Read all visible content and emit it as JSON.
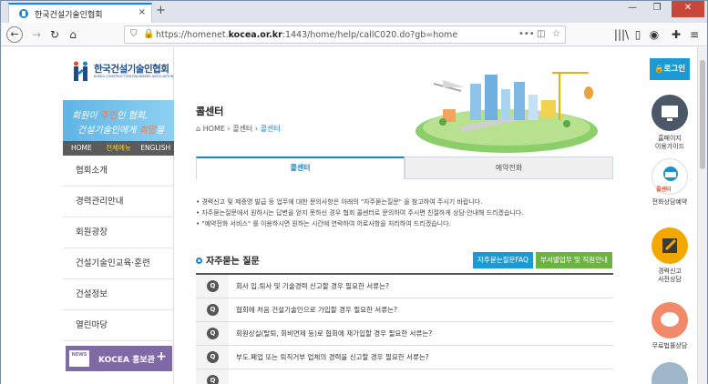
{
  "browser": {
    "tab_title": "한국건설기술인협회",
    "tab_close": "×",
    "new_tab": "+",
    "url_prefix": "https://homenet.",
    "url_domain": "kocea.or.kr",
    "url_suffix": ":1443/home/help/callC020.do?gb=home"
  },
  "logo": {
    "name": "한국건설기술인협회",
    "sub": "KOREA CONSTRUCTION ENGINEERS ASSOCIATION"
  },
  "banner": {
    "line1_a": "회원이 ",
    "line1_hl": "주인",
    "line1_b": "인 협회,",
    "line2_a": "건설기술인에게 ",
    "line2_hl": "희망",
    "line2_b": "을"
  },
  "topmenu": [
    "HOME",
    "전체메뉴",
    "ENGLISH"
  ],
  "sidebar_menu": [
    "협회소개",
    "경력관리안내",
    "회원광장",
    "건설기술인교육·훈련",
    "건설정보",
    "열린마당"
  ],
  "kocea": {
    "news": "NEWS",
    "label": "KOCEA 홍보관",
    "plus": "+"
  },
  "page": {
    "title": "콜센터",
    "breadcrumb": [
      "HOME",
      "콜센터",
      "콜센터"
    ]
  },
  "tabs": [
    "콜센터",
    "예약전화"
  ],
  "notes": [
    "• 경력신고 및 제증명 발급 등 업무에 대한 문의사항은 아래의 \"자주묻는질문\" 을 참고하여 주시기 바랍니다.",
    "• 자주묻는질문에서 원하시는 답변을 얻지 못하신 경우 협회 콜센터로 문의하여 주시면 친절하게 상담·안내해 드리겠습니다.",
    "• \"예약전화 서비스\" 를 이용하시면 원하는 시간에 연락하여 어로사항을 처리하여 드리겠습니다."
  ],
  "faq": {
    "heading": "자주묻는 질문",
    "btn_faq": "자주묻는질문FAQ",
    "btn_dept": "부서별업무 및 직원안내",
    "q_mark": "Q",
    "items": [
      "회사 입.퇴사 및 기술경력 신고할 경우 필요한 서류는?",
      "협회에 처음 건설기술인으로 가입할 경우 필요한 서류는?",
      "회원상실(탈퇴, 회비면제 등)로 협회에 재가입할 경우 필요한 서류는?",
      "부도.폐업 또는 퇴직거부 업체의 경력을 신고할 경우 필요한 서류는?"
    ]
  },
  "quick": {
    "login": "🔒로그인",
    "items": [
      {
        "label": "홈페이지\n이용가이드",
        "icon": "monitor-icon",
        "color": "#4a5868"
      },
      {
        "label": "전화상담예약",
        "icon": "phone-icon",
        "color": "#1c8fd0",
        "inner": "콜센터"
      },
      {
        "label": "경력신고\n사전상담",
        "icon": "pencil-icon",
        "color": "#f2a800"
      },
      {
        "label": "무료법률상담",
        "icon": "chat-icon",
        "color": "#f08a6b"
      }
    ]
  }
}
